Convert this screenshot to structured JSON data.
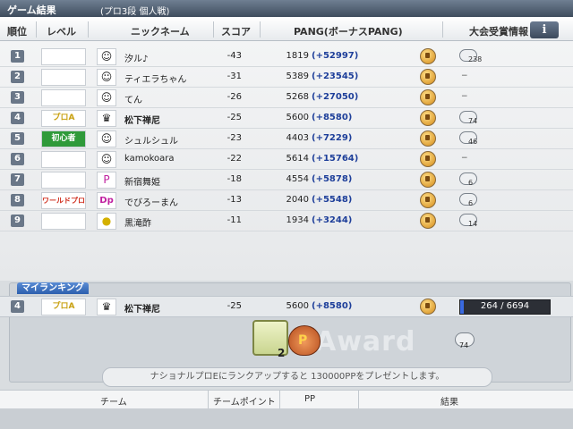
{
  "title": "ゲーム結果",
  "mode": "(プロ3段 個人戦)",
  "headers": {
    "rank": "順位",
    "level": "レベル",
    "nickname": "ニックネーム",
    "score": "スコア",
    "pang": "PANG(ボーナスPANG)",
    "award_info": "大会受賞情報",
    "info_button": "i"
  },
  "rows": [
    {
      "rank": "1",
      "level": "",
      "name": "汐ル♪",
      "score": "-43",
      "pang": "1819",
      "bonus": "(+52997)",
      "award": "238"
    },
    {
      "rank": "2",
      "level": "",
      "name": "ティエラちゃん",
      "score": "-31",
      "pang": "5389",
      "bonus": "(+23545)",
      "award": "−"
    },
    {
      "rank": "3",
      "level": "",
      "name": "てん",
      "score": "-26",
      "pang": "5268",
      "bonus": "(+27050)",
      "award": "−"
    },
    {
      "rank": "4",
      "level": "プロA",
      "name": "松下禅尼",
      "score": "-25",
      "pang": "5600",
      "bonus": "(+8580)",
      "award": "74"
    },
    {
      "rank": "5",
      "level": "初心者",
      "name": "シュルシュル",
      "score": "-23",
      "pang": "4403",
      "bonus": "(+7229)",
      "award": "46"
    },
    {
      "rank": "6",
      "level": "",
      "name": "kamokoara",
      "score": "-22",
      "pang": "5614",
      "bonus": "(+15764)",
      "award": "−"
    },
    {
      "rank": "7",
      "level": "",
      "name": "新宿舞姫",
      "score": "-18",
      "pang": "4554",
      "bonus": "(+5878)",
      "award": "6"
    },
    {
      "rank": "8",
      "level": "ワールドプロE",
      "name": "でびろーまん",
      "score": "-13",
      "pang": "2040",
      "bonus": "(+5548)",
      "award": "6"
    },
    {
      "rank": "9",
      "level": "",
      "name": "黒滝酢",
      "score": "-11",
      "pang": "1934",
      "bonus": "(+3244)",
      "award": "14"
    }
  ],
  "my_ranking": {
    "tab": "マイランキング",
    "rank": "4",
    "level": "プロA",
    "name": "松下禅尼",
    "score": "-25",
    "pang": "5600",
    "bonus": "(+8580)",
    "progress_text": "264 / 6694",
    "progress_fraction": 0.039
  },
  "box_count": "2",
  "small_award_count": "74",
  "award_watermark": "Award",
  "message": "ナショナルプロEにランクアップすると 130000PPをプレゼントします。",
  "footer": {
    "team": "チーム",
    "team_points": "チームポイント",
    "pp": "PP",
    "result": "結果"
  }
}
